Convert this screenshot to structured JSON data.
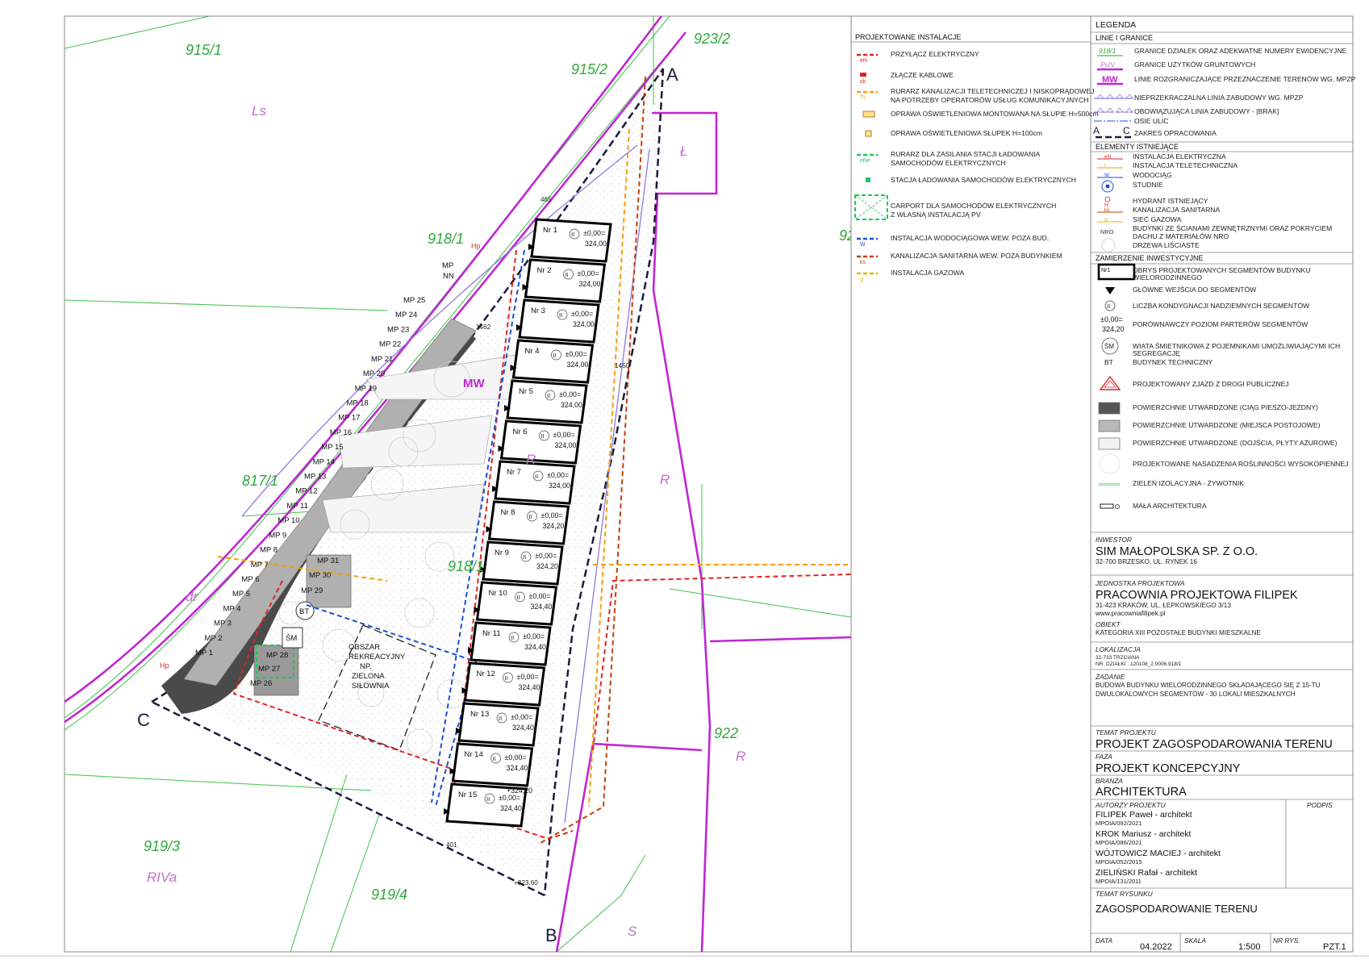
{
  "installations": {
    "header": "PROJEKTOWANE INSTALACJE",
    "items": [
      {
        "label": "PRZYŁĄCZ ELEKTRYCZNY",
        "tag": "eN",
        "style": "dash-red"
      },
      {
        "label": "ZŁĄCZE KABLOWE",
        "tag": "zk",
        "style": "box-red"
      },
      {
        "label": "RURARZ KANALIZACJI TELETECHNICZEJ I NISKOPRĄDOWEJ",
        "label2": "NA POTRZEBY OPERATORÓW USŁUG KOMUNIKACYJNYCH",
        "tag": "Tt",
        "style": "dash-orange"
      },
      {
        "label": "OPRAWA OŚWIETLENIOWA MONTOWANA NA SŁUPIE H=500cm",
        "style": "lamp-pole"
      },
      {
        "label": "OPRAWA OŚWIETLENIOWA SŁUPEK H=100cm",
        "style": "lamp-post"
      },
      {
        "label": "RURARZ DLA ZASILANIA STACJI ŁADOWANIA",
        "label2": "SAMOCHODÓW ELEKTRYCZNYCH",
        "tag": "eNe",
        "style": "dash-green"
      },
      {
        "label": "STACJA ŁADOWANIA SAMOCHODÓW ELEKTRYCZNYCH",
        "style": "green-dot"
      },
      {
        "label": "CARPORT DLA SAMOCHODÓW ELEKTRYCZNYCH",
        "label2": "Z WŁASNĄ INSTALACJĄ PV",
        "style": "carport"
      },
      {
        "label": "INSTALACJA WODOCIĄGOWA WEW. POZA BUD.",
        "tag": "W",
        "style": "dash-blue"
      },
      {
        "label": "KANALIZACJA SANITARNA WEW. POZA BUDYNKIEM",
        "tag": "ks",
        "style": "dash-brown"
      },
      {
        "label": "INSTALACJA GAZOWA",
        "tag": "g",
        "style": "dash-yellow"
      }
    ]
  },
  "legend": {
    "title": "LEGENDA",
    "lines_header": "LINIE I GRANICE",
    "lines": [
      {
        "label": "GRANICE DZIAŁEK ORAZ ADEKWATNE NUMERY EWIDENCYJNE",
        "tag": "918/1"
      },
      {
        "label": "GRANICE UŻYTKÓW GRUNTOWYCH",
        "tag": "PsIV"
      },
      {
        "label": "LINIE ROZGRANICZAJĄCE PRZEZNACZENIE TERENÓW WG. MPZP",
        "tag": "MW"
      },
      {
        "label": "NIEPRZEKRACZALNA LINIA ZABUDOWY WG. MPZP"
      },
      {
        "label": "OBOWIĄZUJĄCA LINIA ZABUDOWY - [BRAK]"
      },
      {
        "label": "OSIE ULIC"
      },
      {
        "label": "ZAKRES OPRACOWANIA",
        "tag_a": "A",
        "tag_c": "C"
      }
    ],
    "existing_header": "ELEMENTY ISTNIEJĄCE",
    "existing": [
      {
        "label": "INSTALACJA ELEKTRYCZNA",
        "tag": "eN"
      },
      {
        "label": "INSTALACJA TELETECHNICZNA",
        "tag": "t"
      },
      {
        "label": "WODOCIĄG",
        "tag": "W"
      },
      {
        "label": "STUDNIE"
      },
      {
        "label": "HYDRANT ISTNIEJĄCY",
        "tag": "H"
      },
      {
        "label": "KANALIZACJA SANITARNA",
        "tag": "ks"
      },
      {
        "label": "SIEĆ GAZOWA",
        "tag": "g"
      },
      {
        "label": "BUDYNKI ZE ŚCIANAMI ZEWNĘTRZNYMI ORAZ POKRYCIEM",
        "label2": "DACHU Z MATERIAŁÓW NRO",
        "tag": "NRO"
      },
      {
        "label": "DRZEWA LIŚCIASTE"
      }
    ],
    "investment_header": "ZAMIERZENIE INWESTYCYJNE",
    "investment": [
      {
        "label": "OBRYS PROJEKTOWANYCH SEGMENTÓW BUDYNKU",
        "label2": "WIELORODZINNEGO",
        "tag": "Nr1"
      },
      {
        "label": "GŁÓWNE WEJŚCIA DO SEGMENTÓW"
      },
      {
        "label": "LICZBA KONDYGNACJI NADZIEMNYCH SEGMENTÓW",
        "tag": "II"
      },
      {
        "label": "PORÓWNAWCZY POZIOM PARTERÓW SEGMENTÓW",
        "tag": "±0,00=",
        "tag2": "324,20"
      },
      {
        "label": "WIATA ŚMIETNIKOWA Z POJEMNIKAMI UMOŻLIWIAJĄCYMI ICH",
        "label2": "SEGREGACJĘ",
        "tag": "ŚM"
      },
      {
        "label": "BUDYNEK TECHNICZNY",
        "tag": "BT"
      },
      {
        "label": "PROJEKTOWANY ZJAZD Z DROGI PUBLICZNEJ"
      },
      {
        "label": "POWIERZCHNIE UTWARDZONE (CIĄG PIESZO-JEZDNY)",
        "fill": "#555555"
      },
      {
        "label": "POWIERZCHNIE UTWARDZONE (MIEJSCA POSTOJOWE)",
        "fill": "#b8b8b8"
      },
      {
        "label": "POWIERZCHNIE UTWARDZONE (DOJŚCIA, PŁYTY AŻUROWE)",
        "fill": "#f2f2f2"
      },
      {
        "label": "PROJEKTOWANE NASADZENIA ROŚLINNOŚCI WYSOKOPIENNEJ"
      },
      {
        "label": "ZIELEŃ IZOLACYJNA - ŻYWOTNIK"
      },
      {
        "label": "MAŁA ARCHITEKTURA"
      }
    ]
  },
  "titleblock": {
    "investor_label": "INWESTOR",
    "investor_name": "SIM MAŁOPOLSKA SP. Z O.O.",
    "investor_address": "32-700 BRZESKO, UL. RYNEK 16",
    "unit_label": "JEDNOSTKA PROJEKTOWA",
    "unit_name": "PRACOWNIA PROJEKTOWA FILIPEK",
    "unit_address": "31-423 KRAKÓW, UL. ŁEPKOWSKIEGO 3/13",
    "unit_web": "www.pracowniafilipek.pl",
    "object_label": "OBIEKT",
    "object_category": "KATEGORIA XIII   POZOSTAŁE BUDYNKI MIESZKALNE",
    "location_label": "LOKALIZACJA",
    "location_line1": "32-733 TRZCIANA",
    "location_line2": "NR. DZIAŁKI : 120108_2.0006.918/1",
    "task_label": "ZADANIE",
    "task_line1": "BUDOWA BUDYNKU WIELORODZINNEGO SKŁADAJĄCEGO SIĘ Z 15-TU",
    "task_line2": "DWULOKALOWYCH SEGMENTÓW - 30 LOKALI MIESZKALNYCH",
    "topic_label": "TEMAT PROJEKTU",
    "topic": "PROJEKT ZAGOSPODAROWANIA TERENU",
    "phase_label": "FAZA",
    "phase": "PROJEKT KONCEPCYJNY",
    "branch_label": "BRANŻA",
    "branch": "ARCHITEKTURA",
    "authors_label": "AUTORZY PROJEKTU",
    "signature_label": "PODPIS",
    "authors": [
      {
        "name": "FILIPEK Paweł - architekt",
        "license": "MPOIA/092/2021"
      },
      {
        "name": "KROK Mariusz - architekt",
        "license": "MPOIA/086/2021"
      },
      {
        "name": "WÓJTOWICZ MACIEJ - architekt",
        "license": "MPOIA/052/2015"
      },
      {
        "name": "ZIELIŃSKI Rafał - architekt",
        "license": "MPOIA/131/2011"
      }
    ],
    "drawing_label": "TEMAT RYSUNKU",
    "drawing_title": "ZAGOSPODAROWANIE TERENU",
    "date_label": "DATA",
    "date": "04.2022",
    "scale_label": "SKALA",
    "scale": "1:500",
    "sheet_label": "NR RYS.",
    "sheet": "PZT.1"
  },
  "plan": {
    "parcels": [
      "915/1",
      "915/2",
      "923/2",
      "918/1",
      "817/1",
      "918/1",
      "919/3",
      "919/4",
      "922",
      "92"
    ],
    "land_uses": [
      "Ls",
      "Ł",
      "R",
      "R",
      "R",
      "dr",
      "RIVa",
      "S",
      "R"
    ],
    "zone_label": "MW",
    "section_letters": [
      "A",
      "B",
      "C"
    ],
    "elevation_bottom": "+323,60",
    "dims": [
      "465",
      "1462",
      "1450",
      "401"
    ],
    "segments": [
      {
        "nr": "Nr 1",
        "lvl": "±0,00=",
        "lvl2": "324,00"
      },
      {
        "nr": "Nr 2",
        "lvl": "±0,00=",
        "lvl2": "324,00"
      },
      {
        "nr": "Nr 3",
        "lvl": "±0,00=",
        "lvl2": "324,00"
      },
      {
        "nr": "Nr 4",
        "lvl": "±0,00=",
        "lvl2": "324,00"
      },
      {
        "nr": "Nr 5",
        "lvl": "±0,00=",
        "lvl2": "324,00"
      },
      {
        "nr": "Nr 6",
        "lvl": "±0,00=",
        "lvl2": "324,00"
      },
      {
        "nr": "Nr 7",
        "lvl": "±0,00=",
        "lvl2": "324,00"
      },
      {
        "nr": "Nr 8",
        "lvl": "±0,00=",
        "lvl2": "324,20"
      },
      {
        "nr": "Nr 9",
        "lvl": "±0,00=",
        "lvl2": "324,20"
      },
      {
        "nr": "Nr 10",
        "lvl": "±0,00=",
        "lvl2": "324,40"
      },
      {
        "nr": "Nr 11",
        "lvl": "±0,00=",
        "lvl2": "324,40"
      },
      {
        "nr": "Nr 12",
        "lvl": "±0,00=",
        "lvl2": "324,40"
      },
      {
        "nr": "Nr 13",
        "lvl": "±0,00=",
        "lvl2": "324,40"
      },
      {
        "nr": "Nr 14",
        "lvl": "±0,00=",
        "lvl2": "324,40"
      },
      {
        "nr": "Nr 15",
        "lvl": "±0,00=",
        "lvl2": "324,40",
        "extra": "+324,20"
      }
    ],
    "floors": "II",
    "parking_left": [
      "MP 1",
      "MP 2",
      "MP 3",
      "MP 4",
      "MP 5",
      "MP 6",
      "MP 7",
      "MP 8",
      "MP 9",
      "MP 10",
      "MP 11",
      "MP 12",
      "MP 13",
      "MP 14",
      "MP 15",
      "MP 16",
      "MP 17",
      "MP 18",
      "MP 19",
      "MP 20",
      "MP 21",
      "MP 22",
      "MP 23",
      "MP 24",
      "MP 25"
    ],
    "parking_nn": [
      "MP",
      "NN"
    ],
    "parking_right": [
      "MP 31",
      "MP 30",
      "MP 29"
    ],
    "parking_ev": [
      "MP 28",
      "MP 27",
      "MP 26"
    ],
    "bt": "BT",
    "sm": "ŚM",
    "recreation": [
      "OBSZAR",
      "REKREACYJNY",
      "NP.",
      "ZIELONA",
      "SIŁOWNIA"
    ],
    "hydrant": "Hp"
  }
}
